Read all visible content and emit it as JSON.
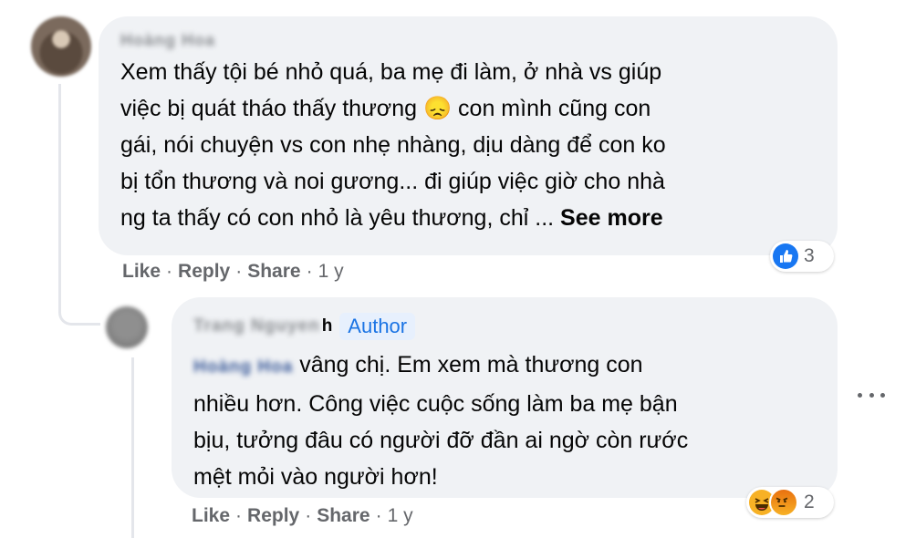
{
  "comment": {
    "author": "Hoàng Hoa",
    "text": "Xem thấy tội bé nhỏ quá, ba mẹ đi làm, ở nhà vs giúp việc bị quát tháo thấy thương 😞 con mình cũng con gái, nói chuyện vs con nhẹ nhàng, dịu dàng để con ko bị tổn thương và noi gương... đi giúp việc giờ cho nhà ng ta thấy có con nhỏ là yêu thương, chỉ ...",
    "lines": [
      "Xem thấy tội bé nhỏ quá, ba mẹ đi làm, ở nhà vs giúp",
      "việc bị quát tháo thấy thương",
      "con mình cũng con",
      "gái, nói chuyện vs con nhẹ nhàng, dịu dàng để con ko",
      "bị tổn thương và noi gương... đi giúp việc giờ cho nhà",
      "ng ta thấy có con nhỏ là yêu thương, chỉ ..."
    ],
    "emoji": "😞",
    "see_more": "See more",
    "reaction_count": "3",
    "reaction_icons": [
      "like-icon"
    ],
    "actions": {
      "like": "Like",
      "reply": "Reply",
      "share": "Share",
      "time": "1 y"
    }
  },
  "reply": {
    "author": "Trang Nguyen",
    "author_badge": "Author",
    "mention": "Hoàng Hoa",
    "lines": [
      "vâng chị. Em xem mà thương con",
      "nhiều hơn. Công việc cuộc sống làm ba mẹ bận",
      "bịu, tưởng đâu có người đỡ đần ai ngờ còn rước",
      "mệt mỏi vào người hơn!"
    ],
    "reaction_count": "2",
    "reaction_icons": [
      "haha-icon",
      "angry-icon"
    ],
    "actions": {
      "like": "Like",
      "reply": "Reply",
      "share": "Share",
      "time": "1 y"
    }
  },
  "colors": {
    "bubble": "#f0f2f5",
    "meta": "#65676b",
    "accent": "#1877f2"
  }
}
